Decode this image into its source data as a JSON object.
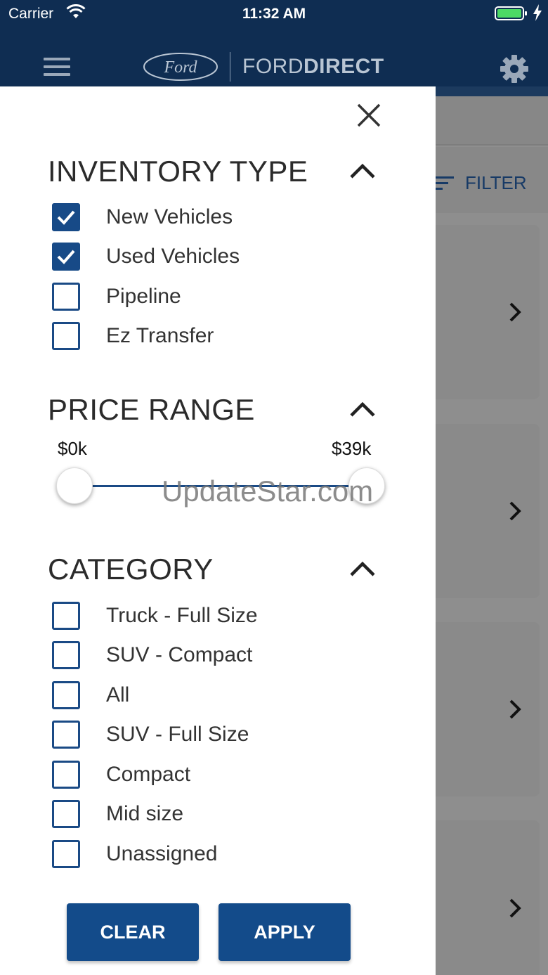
{
  "status_bar": {
    "carrier": "Carrier",
    "time": "11:32 AM"
  },
  "header": {
    "brand_light": "FORD",
    "brand_bold": "DIRECT",
    "logo_text": "Ford"
  },
  "background": {
    "filter_label": "FILTER"
  },
  "filters": {
    "inventory_type": {
      "title": "INVENTORY TYPE",
      "options": [
        {
          "label": "New Vehicles",
          "checked": true
        },
        {
          "label": "Used Vehicles",
          "checked": true
        },
        {
          "label": "Pipeline",
          "checked": false
        },
        {
          "label": "Ez Transfer",
          "checked": false
        }
      ]
    },
    "price_range": {
      "title": "PRICE RANGE",
      "min_label": "$0k",
      "max_label": "$39k"
    },
    "category": {
      "title": "CATEGORY",
      "options": [
        {
          "label": "Truck - Full Size",
          "checked": false
        },
        {
          "label": "SUV - Compact",
          "checked": false
        },
        {
          "label": "All",
          "checked": false
        },
        {
          "label": "SUV - Full Size",
          "checked": false
        },
        {
          "label": "Compact",
          "checked": false
        },
        {
          "label": "Mid size",
          "checked": false
        },
        {
          "label": "Unassigned",
          "checked": false
        }
      ]
    }
  },
  "buttons": {
    "clear": "CLEAR",
    "apply": "APPLY"
  },
  "watermark": "UpdateStar.com",
  "colors": {
    "header_bg": "#0f2d52",
    "accent": "#134b8a",
    "overlay": "#8e8e8e"
  }
}
